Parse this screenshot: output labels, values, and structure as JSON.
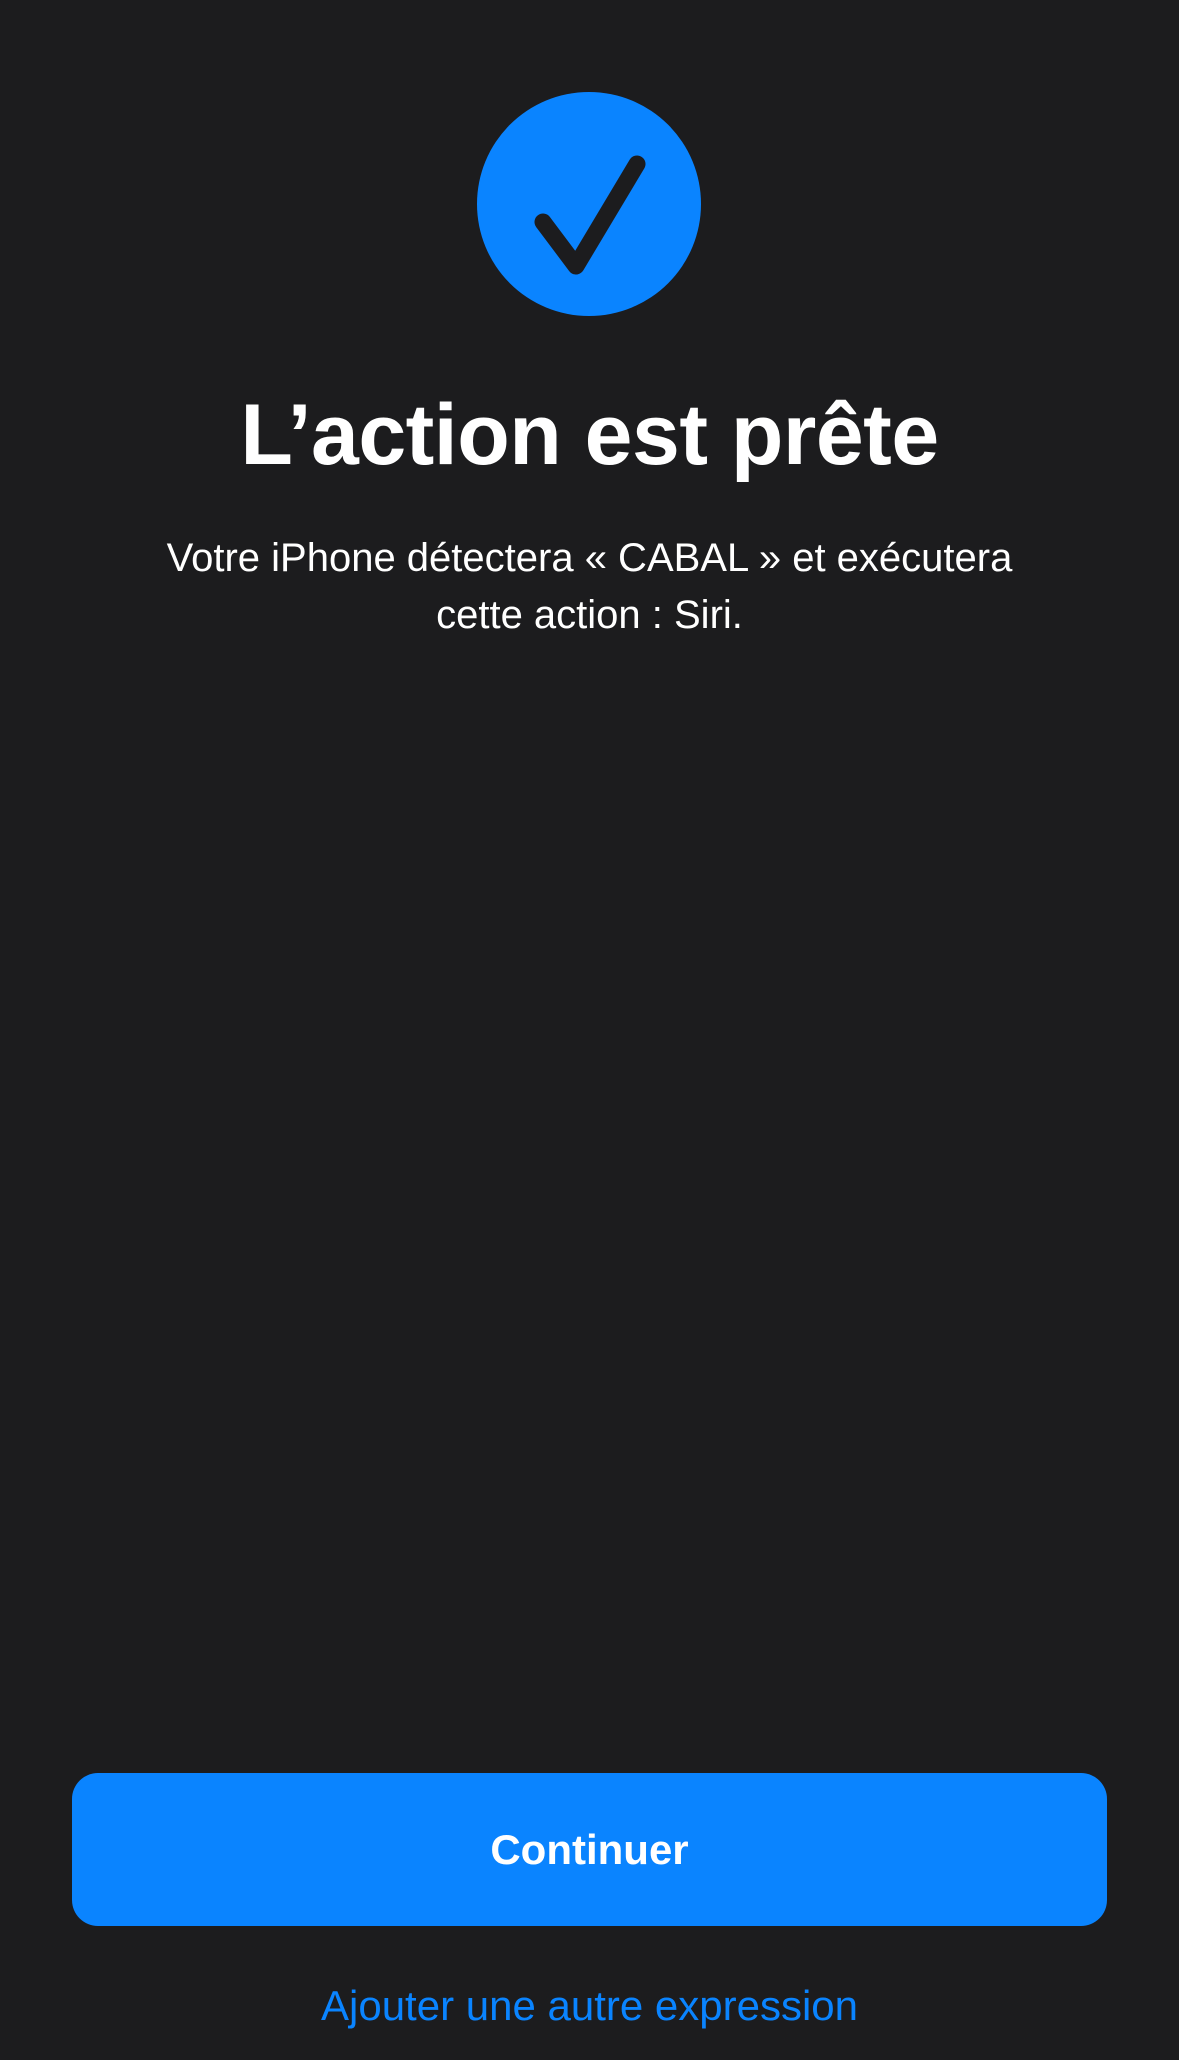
{
  "icon": "checkmark-circle-icon",
  "colors": {
    "background": "#1c1c1e",
    "accent": "#0a84ff",
    "text": "#ffffff"
  },
  "title": "L’action est prête",
  "description": {
    "line1": "Votre iPhone détectera « CABAL » et exécutera",
    "line2": "cette action : Siri."
  },
  "buttons": {
    "continue_label": "Continuer",
    "add_expression_label": "Ajouter une autre expression"
  }
}
